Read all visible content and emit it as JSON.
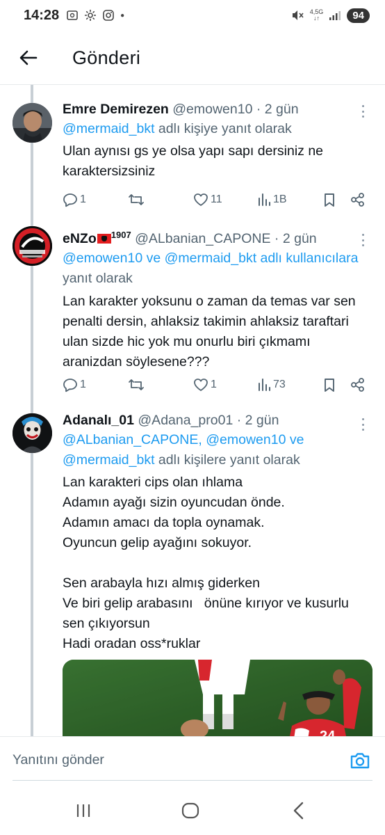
{
  "status_bar": {
    "time": "14:28",
    "network_top": "4,5G",
    "network_bottom": "↓↑",
    "battery": "94"
  },
  "header": {
    "title": "Gönderi"
  },
  "tweets": [
    {
      "name": "Emre Demirezen",
      "handle": "@emowen10",
      "time": "· 2 gün",
      "reply_mentions": "@mermaid_bkt",
      "reply_suffix": " adlı kişiye yanıt olarak",
      "text": "Ulan aynısı gs ye olsa yapı sapı dersiniz ne karaktersizsiniz",
      "replies": "1",
      "retweets": "",
      "likes": "11",
      "views": "1B"
    },
    {
      "name": "eNZo",
      "name_suffix": "1907",
      "handle": "@ALbanian_CAPONE",
      "time": "· 2 gün",
      "reply_mentions": "@emowen10 ve @mermaid_bkt adlı kullanıcılara",
      "reply_suffix": " yanıt olarak",
      "text": "Lan karakter yoksunu o zaman da temas var sen penalti dersin, ahlaksiz takimin ahlaksiz taraftari ulan sizde hic yok mu onurlu biri çıkmamı aranizdan söylesene???",
      "replies": "1",
      "retweets": "",
      "likes": "1",
      "views": "73"
    },
    {
      "name": "Adanalı_01",
      "handle": "@Adana_pro01",
      "time": "· 2 gün",
      "reply_mentions_1": "@ALbanian_CAPONE, @emowen10 ve",
      "reply_mentions_2": "@mermaid_bkt",
      "reply_suffix": " adlı kişilere yanıt olarak",
      "text": "Lan karakteri cips olan ıhlama\nAdamın ayağı sizin oyuncudan önde.\nAdamın amacı da topla oynamak.\nOyuncun gelip ayağını sokuyor.\n\nSen arabayla hızı almış giderken\nVe biri gelip arabasını   önüne kırıyor ve kusurlu sen çıkıyorsun\nHadi oradan oss*ruklar"
    }
  ],
  "reply_bar": {
    "placeholder": "Yanıtını gönder"
  },
  "colors": {
    "link": "#1d9bf0",
    "secondary_text": "#536471",
    "thread_line": "#c8cfd5"
  }
}
